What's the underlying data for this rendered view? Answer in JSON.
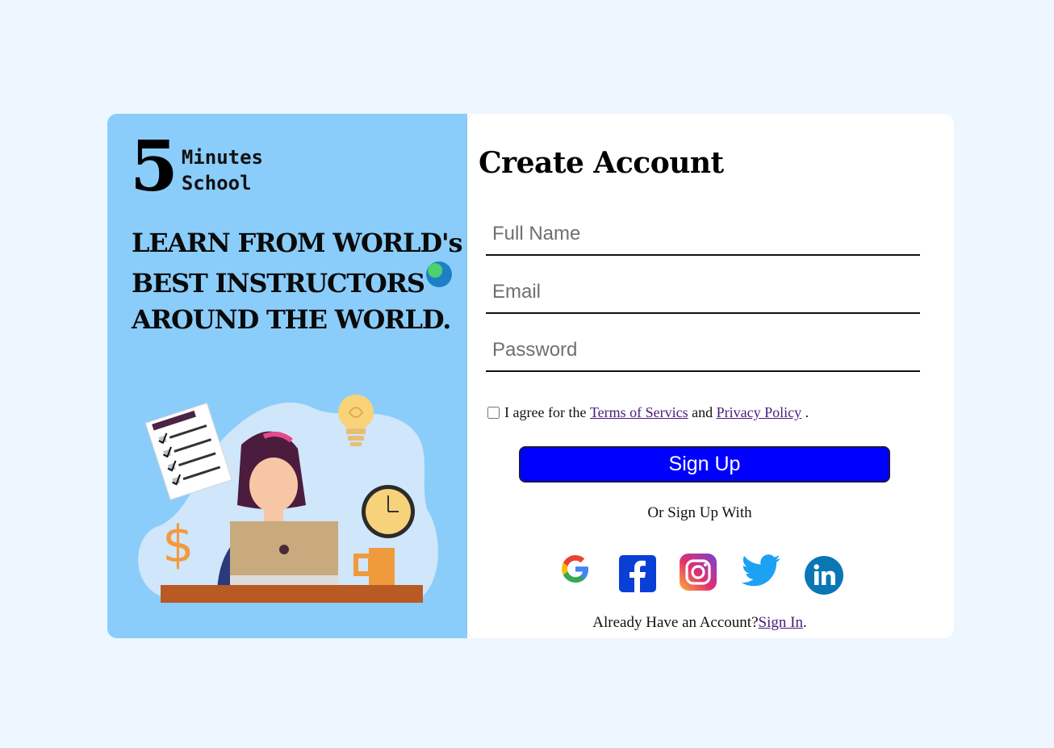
{
  "brand": {
    "number": "5",
    "line1": "Minutes",
    "line2": "School"
  },
  "hero": {
    "line1": "LEARN FROM WORLD's",
    "line2": "BEST INSTRUCTORS",
    "line3": "AROUND THE WORLD.",
    "icon": "globe-icon"
  },
  "form": {
    "title": "Create Account",
    "fullname_placeholder": "Full Name",
    "email_placeholder": "Email",
    "password_placeholder": "Password",
    "agree_prefix": "I agree for the ",
    "terms_link": "Terms of Servics ",
    "agree_and": "and ",
    "privacy_link": "Privacy Policy ",
    "agree_suffix": ".",
    "signup_label": "Sign Up",
    "or_text": "Or Sign Up With",
    "already_text": "Already Have an Account?",
    "signin_link": "Sign In",
    "signin_suffix": "."
  },
  "socials": [
    {
      "name": "google-icon",
      "color": "#4285F4"
    },
    {
      "name": "facebook-icon",
      "color": "#0a3fd6"
    },
    {
      "name": "instagram-icon",
      "color": "#e1306c"
    },
    {
      "name": "twitter-icon",
      "color": "#1da1f2"
    },
    {
      "name": "linkedin-icon",
      "color": "#0a77b5"
    }
  ],
  "colors": {
    "page_bg": "#eef6ff",
    "left_panel": "#8bcdfa",
    "signup_button": "#0000ff",
    "link": "#4a1b7a"
  }
}
